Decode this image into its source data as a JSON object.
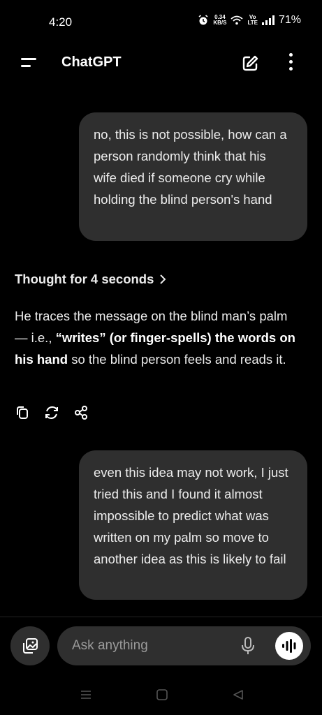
{
  "status": {
    "time": "4:20",
    "speed_value": "0.34",
    "speed_unit": "KB/S",
    "volte_top": "Vo",
    "volte_bottom": "LTE",
    "battery": "71%"
  },
  "header": {
    "title": "ChatGPT"
  },
  "messages": [
    {
      "role": "user",
      "text": "no, this is not possible, how can a person randomly think that his wife died if someone cry while holding the blind person's hand"
    },
    {
      "role": "assistant",
      "thought_label": "Thought for 4 seconds",
      "text_intro": "He traces the message on the blind man’s palm — i.e., ",
      "text_bold": "“writes” (or finger-spells) the words on his hand",
      "text_outro": " so the blind person feels and reads it."
    },
    {
      "role": "user",
      "text": "even this idea may not work, I just tried this and I found it almost impossible to predict what was written on my palm so move to another idea as this is likely to fail"
    }
  ],
  "composer": {
    "placeholder": "Ask anything"
  },
  "colors": {
    "background": "#000000",
    "bubble": "#2f2f2f",
    "text": "#ececec",
    "placeholder": "#9b9b9b"
  }
}
